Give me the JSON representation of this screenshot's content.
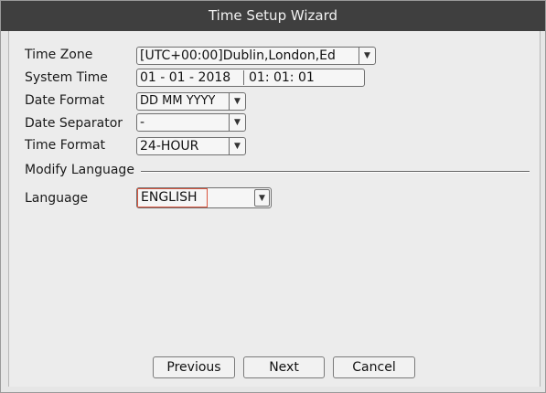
{
  "window": {
    "title": "Time Setup Wizard"
  },
  "time_zone": {
    "label": "Time Zone",
    "value": "[UTC+00:00]Dublin,London,Ed",
    "dropdown_icon": "triangle-down"
  },
  "system_time": {
    "label": "System Time",
    "date": "01 - 01 - 2018",
    "time": "01: 01: 01"
  },
  "date_format": {
    "label": "Date Format",
    "value": "DD MM YYYY",
    "dropdown_icon": "triangle-down"
  },
  "date_separator": {
    "label": "Date Separator",
    "value": "-",
    "dropdown_icon": "triangle-down"
  },
  "time_format": {
    "label": "Time Format",
    "value": "24-HOUR",
    "dropdown_icon": "triangle-down"
  },
  "modify_language": {
    "label": "Modify Language"
  },
  "language": {
    "label": "Language",
    "value": "ENGLISH",
    "dropdown_icon": "triangle-down",
    "highlight_color": "#d9553e"
  },
  "buttons": {
    "previous": "Previous",
    "next": "Next",
    "cancel": "Cancel"
  }
}
